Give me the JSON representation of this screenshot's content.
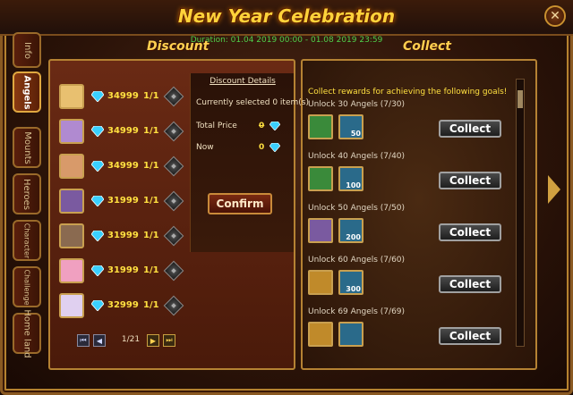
{
  "window": {
    "title": "New Year Celebration",
    "duration": "Duration: 01.04 2019 00:00 - 01.08 2019 23:59"
  },
  "side_tabs": [
    {
      "label": "Info",
      "active": false
    },
    {
      "label": "Angels",
      "active": true
    },
    {
      "label": "Mounts",
      "active": false
    },
    {
      "label": "Heroes",
      "active": false
    },
    {
      "label": "Character",
      "active": false
    },
    {
      "label": "Challenge",
      "active": false
    },
    {
      "label": "Home land",
      "active": false
    }
  ],
  "discount": {
    "header": "Discount",
    "items": [
      {
        "price": "34999",
        "qty": "1/1",
        "avatar_color": "#e8c070"
      },
      {
        "price": "34999",
        "qty": "1/1",
        "avatar_color": "#b08ad0"
      },
      {
        "price": "34999",
        "qty": "1/1",
        "avatar_color": "#d89a6a"
      },
      {
        "price": "31999",
        "qty": "1/1",
        "avatar_color": "#7a5aa0"
      },
      {
        "price": "31999",
        "qty": "1/1",
        "avatar_color": "#8a6a50"
      },
      {
        "price": "31999",
        "qty": "1/1",
        "avatar_color": "#f0a0c0"
      },
      {
        "price": "32999",
        "qty": "1/1",
        "avatar_color": "#e0d0f0"
      }
    ],
    "details": {
      "title": "Discount Details",
      "selected": "Currently selected 0 item(s)",
      "total_label": "Total Price",
      "total_value": "0",
      "now_label": "Now",
      "now_value": "0"
    },
    "confirm_label": "Confirm",
    "pager": {
      "page": "1/21"
    }
  },
  "collect": {
    "header": "Collect",
    "intro": "Collect rewards for achieving the following goals!",
    "goals": [
      {
        "label": "Unlock 30 Angels (7/30)",
        "reward_qty": "50",
        "chest_color": "#3a8a3a",
        "button": "Collect"
      },
      {
        "label": "Unlock 40 Angels (7/40)",
        "reward_qty": "100",
        "chest_color": "#3a8a3a",
        "button": "Collect"
      },
      {
        "label": "Unlock 50 Angels (7/50)",
        "reward_qty": "200",
        "chest_color": "#7a5aa0",
        "button": "Collect"
      },
      {
        "label": "Unlock 60 Angels (7/60)",
        "reward_qty": "300",
        "chest_color": "#c08a2a",
        "button": "Collect"
      },
      {
        "label": "Unlock 69 Angels (7/69)",
        "reward_qty": "",
        "chest_color": "#c08a2a",
        "button": "Collect"
      }
    ]
  },
  "colors": {
    "accent": "#ffd23a",
    "gem": "#3ad0ff",
    "price": "#ffe040",
    "duration": "#4fd04a"
  }
}
